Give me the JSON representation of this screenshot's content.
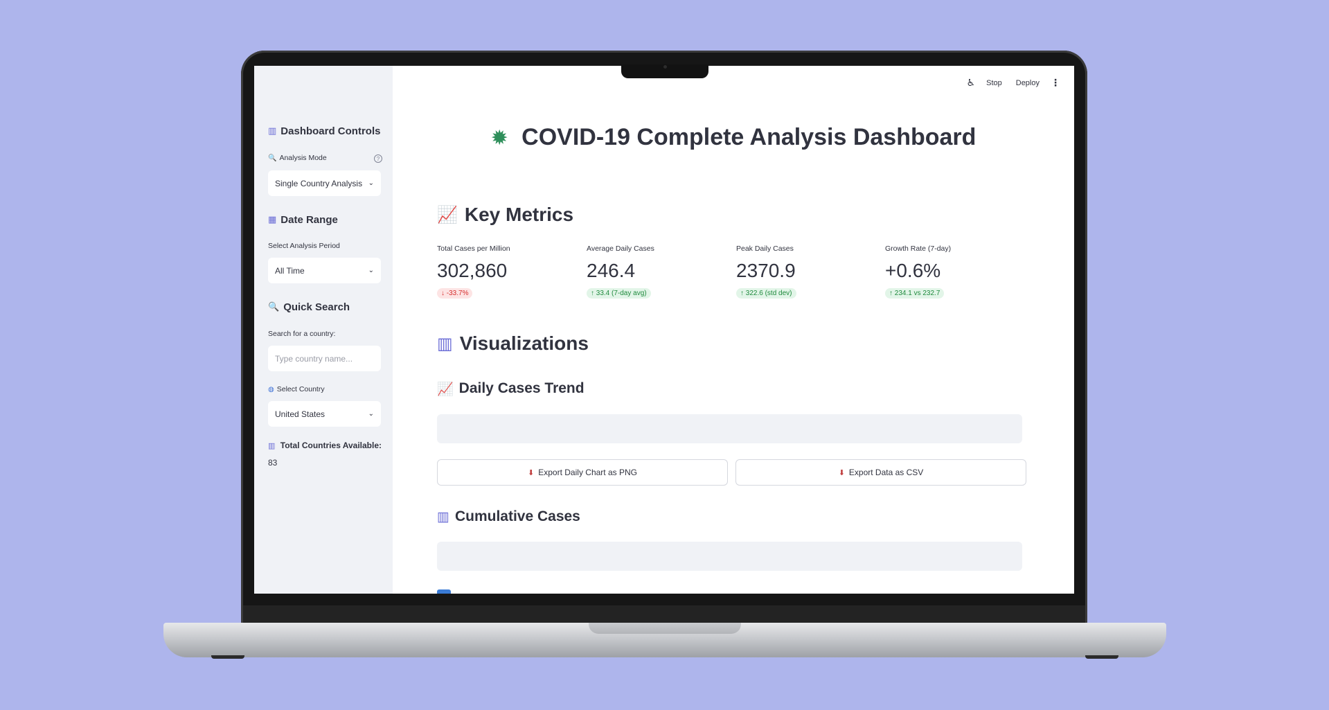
{
  "topbar": {
    "stop_label": "Stop",
    "deploy_label": "Deploy"
  },
  "sidebar": {
    "controls_title": "Dashboard Controls",
    "analysis_mode_label": "Analysis Mode",
    "analysis_mode_value": "Single Country Analysis",
    "date_range_title": "Date Range",
    "period_label": "Select Analysis Period",
    "period_value": "All Time",
    "quick_search_title": "Quick Search",
    "search_label": "Search for a country:",
    "search_placeholder": "Type country name...",
    "search_value": "",
    "country_label": "Select Country",
    "country_value": "United States",
    "total_label": "Total Countries Available:",
    "total_value": "83"
  },
  "main": {
    "title": "COVID-19 Complete Analysis Dashboard",
    "key_metrics_heading": "Key Metrics",
    "metrics": [
      {
        "label": "Total Cases per Million",
        "value": "302,860",
        "delta": "-33.7%",
        "direction": "down"
      },
      {
        "label": "Average Daily Cases",
        "value": "246.4",
        "delta": "33.4 (7-day avg)",
        "direction": "up"
      },
      {
        "label": "Peak Daily Cases",
        "value": "2370.9",
        "delta": "322.6 (std dev)",
        "direction": "up"
      },
      {
        "label": "Growth Rate (7-day)",
        "value": "+0.6%",
        "delta": "234.1 vs 232.7",
        "direction": "up"
      }
    ],
    "visualizations_heading": "Visualizations",
    "daily_trend_heading": "Daily Cases Trend",
    "export_png_label": "Export Daily Chart as PNG",
    "export_csv_label": "Export Data as CSV",
    "cumulative_heading": "Cumulative Cases"
  },
  "icons": {
    "title_icon": "virus-icon",
    "chart_up_icon": "chart-increasing-icon",
    "bar_chart_icon": "bar-chart-icon",
    "calendar_icon": "calendar-icon",
    "search_icon": "magnifier-icon",
    "globe_icon": "globe-icon",
    "download_icon": "download-icon"
  },
  "colors": {
    "background": "#aeb5ec",
    "sidebar_bg": "#f0f2f6",
    "text": "#31333f",
    "delta_down": "#d62d2d",
    "delta_up": "#1f8a3d"
  }
}
